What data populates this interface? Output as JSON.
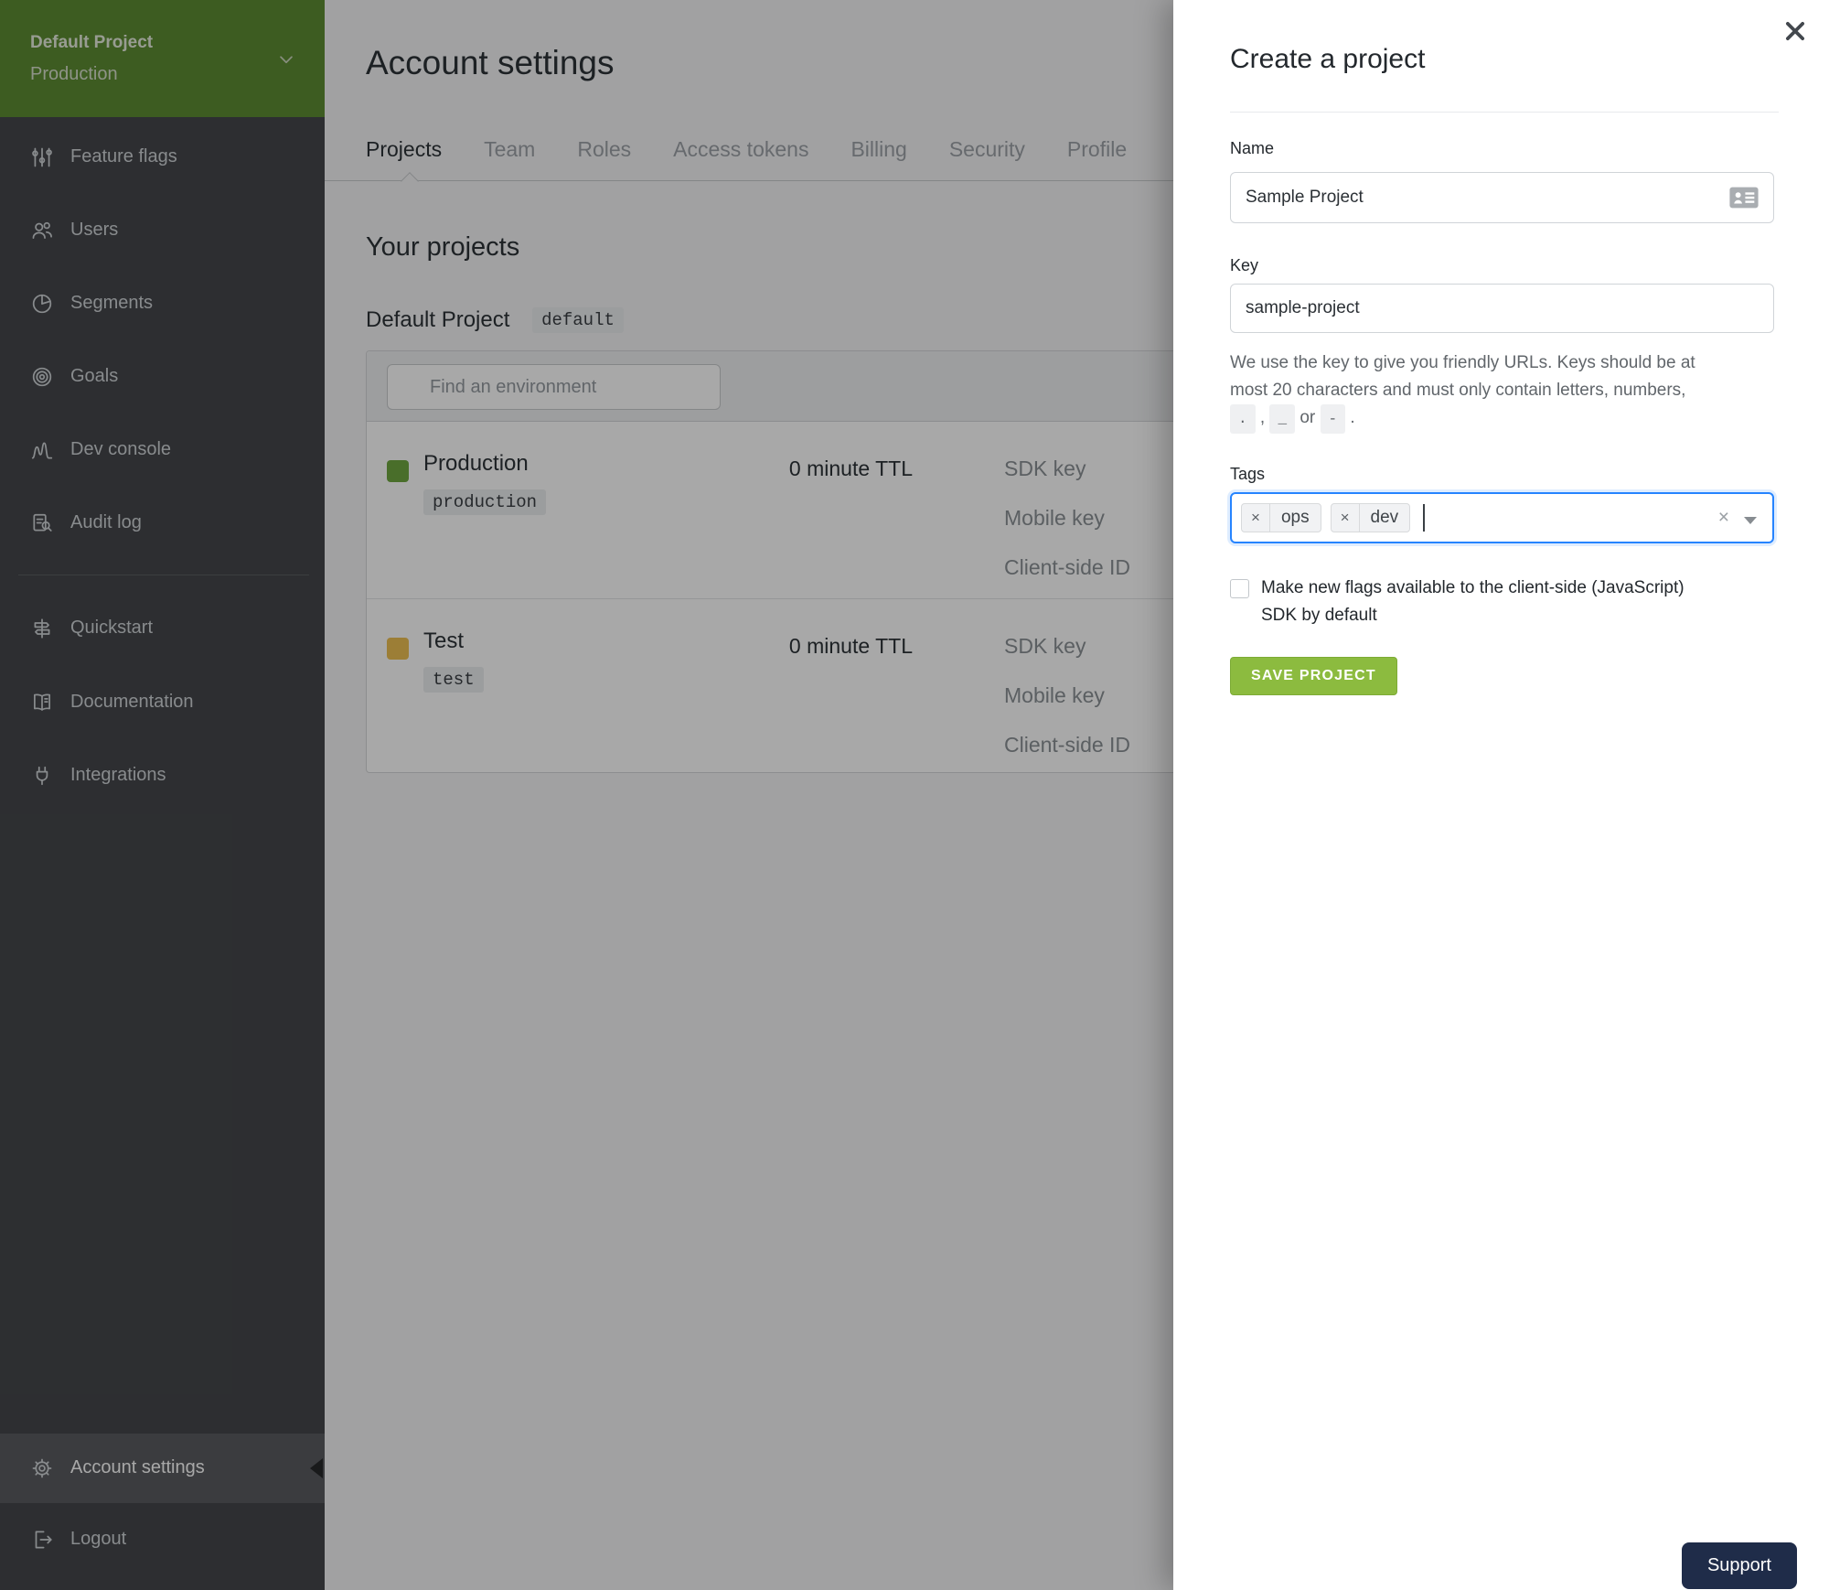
{
  "colors": {
    "sidebar_green": "#5d8c33",
    "production_env": "#6fa840",
    "test_env": "#edbf53",
    "save_button_green": "#8cbb3f",
    "focus_blue": "#2684ff",
    "support_navy": "#1f2c49"
  },
  "sidebar": {
    "project_switcher": {
      "project": "Default Project",
      "environment": "Production"
    },
    "items": [
      {
        "label": "Feature flags",
        "icon": "sliders-icon"
      },
      {
        "label": "Users",
        "icon": "users-icon"
      },
      {
        "label": "Segments",
        "icon": "pie-icon"
      },
      {
        "label": "Goals",
        "icon": "target-icon"
      },
      {
        "label": "Dev console",
        "icon": "waveform-icon"
      },
      {
        "label": "Audit log",
        "icon": "audit-log-icon"
      },
      {
        "label": "Quickstart",
        "icon": "signpost-icon"
      },
      {
        "label": "Documentation",
        "icon": "book-icon"
      },
      {
        "label": "Integrations",
        "icon": "plug-icon"
      }
    ],
    "account_settings": {
      "label": "Account settings",
      "active": true
    },
    "logout": {
      "label": "Logout"
    }
  },
  "main": {
    "title": "Account settings",
    "tabs": [
      {
        "label": "Projects",
        "active": true
      },
      {
        "label": "Team"
      },
      {
        "label": "Roles"
      },
      {
        "label": "Access tokens"
      },
      {
        "label": "Billing"
      },
      {
        "label": "Security"
      },
      {
        "label": "Profile"
      }
    ],
    "section_title": "Your projects",
    "project": {
      "name": "Default Project",
      "key_badge": "default",
      "search_placeholder": "Find an environment",
      "environments": [
        {
          "name": "Production",
          "key": "production",
          "ttl": "0 minute TTL",
          "color": "#6fa840",
          "links": [
            "SDK key",
            "Mobile key",
            "Client-side ID"
          ]
        },
        {
          "name": "Test",
          "key": "test",
          "ttl": "0 minute TTL",
          "color": "#edbf53",
          "links": [
            "SDK key",
            "Mobile key",
            "Client-side ID"
          ]
        }
      ]
    }
  },
  "modal": {
    "title": "Create a project",
    "fields": {
      "name": {
        "label": "Name",
        "value": "Sample Project"
      },
      "key": {
        "label": "Key",
        "value": "sample-project",
        "help_line1": "We use the key to give you friendly URLs. Keys should be at",
        "help_line2": "most 20 characters and must only contain letters, numbers,",
        "chars": [
          ".",
          "_",
          "-"
        ],
        "sep_comma": ",",
        "sep_or": "or",
        "sep_period": "."
      },
      "tags": {
        "label": "Tags",
        "tags": [
          "ops",
          "dev"
        ],
        "remove_symbol": "×",
        "clear_symbol": "×"
      }
    },
    "checkbox": {
      "checked": false,
      "line1": "Make new flags available to the client-side (JavaScript)",
      "line2": "SDK by default"
    },
    "save_label": "SAVE PROJECT"
  },
  "support": {
    "label": "Support"
  }
}
